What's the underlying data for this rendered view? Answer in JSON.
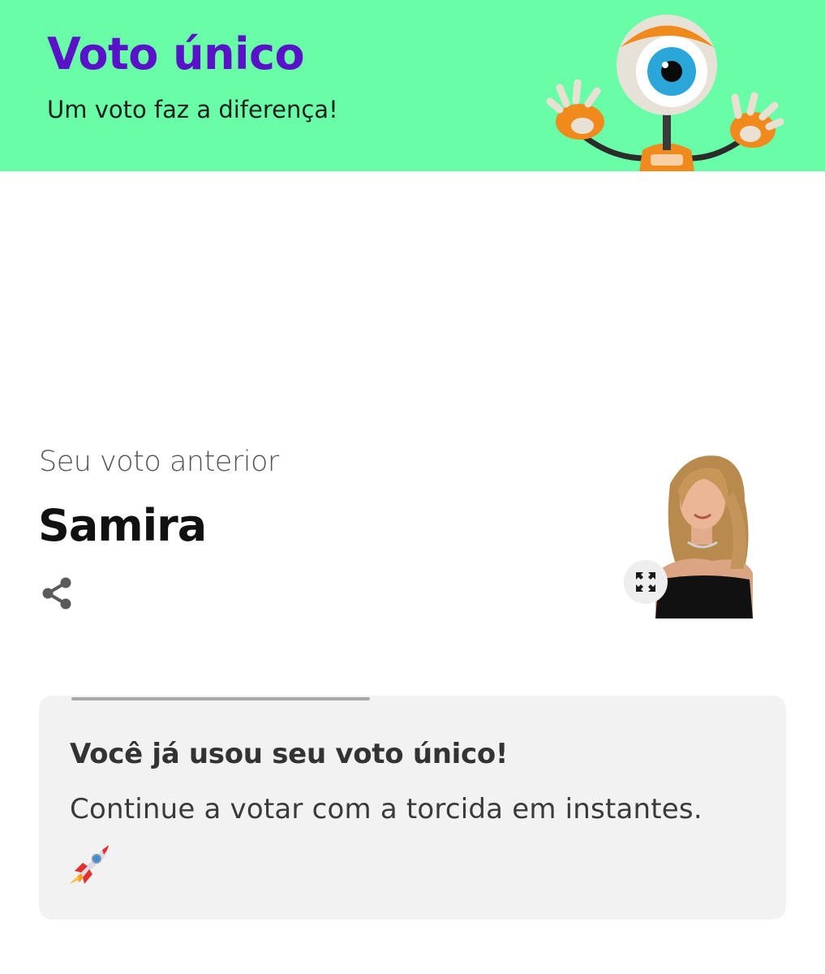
{
  "banner": {
    "title": "Voto único",
    "subtitle": "Um voto faz a diferença!",
    "background_color": "#68fda6",
    "title_color": "#5a12c8"
  },
  "previous_vote": {
    "label": "Seu voto anterior",
    "candidate_name": "Samira",
    "share_icon": "share-icon",
    "expand_icon": "expand-icon"
  },
  "card": {
    "title": "Você já usou seu voto único!",
    "message": "Continue a votar com a torcida em instantes.",
    "emoji_icon": "rocket-icon",
    "progress_fraction": 0.4
  }
}
